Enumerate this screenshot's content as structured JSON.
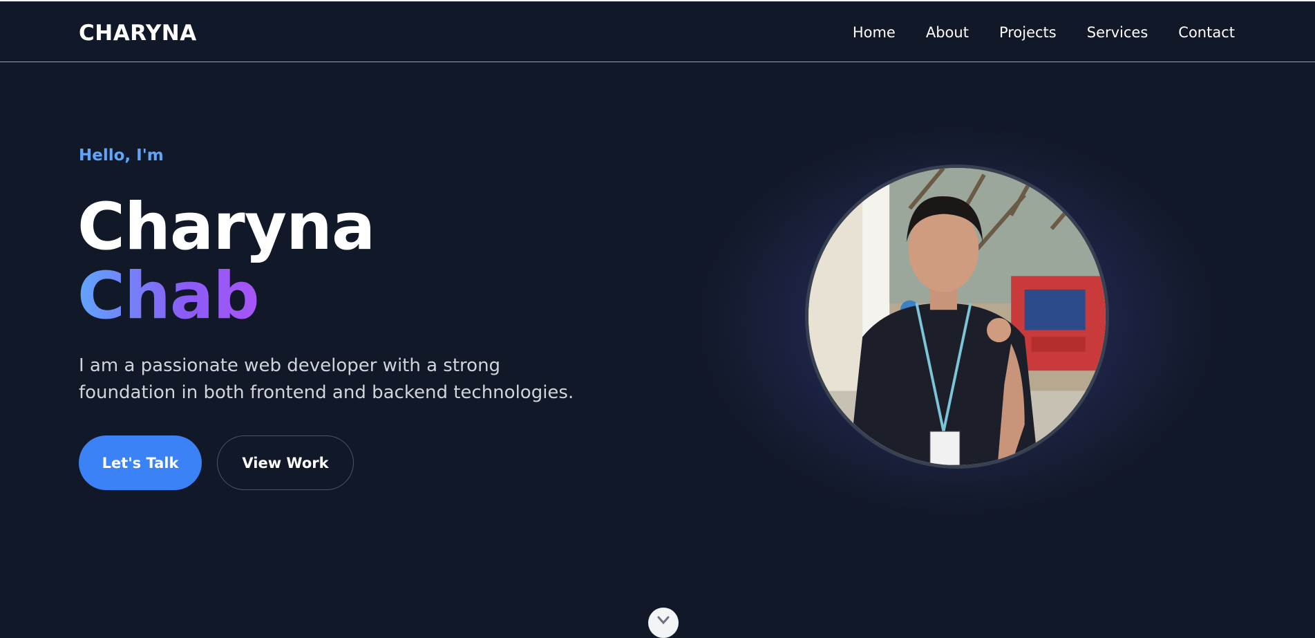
{
  "header": {
    "logo": "CHARYNA",
    "nav": [
      "Home",
      "About",
      "Projects",
      "Services",
      "Contact"
    ]
  },
  "hero": {
    "greeting": "Hello, I'm",
    "first_name": "Charyna",
    "last_name": "Chab",
    "intro": "I am a passionate web developer with a strong foundation in both frontend and backend technologies.",
    "primary_button": "Let's Talk",
    "secondary_button": "View Work"
  },
  "icons": {
    "scroll": "chevron-down-icon",
    "photo": "profile-photo"
  },
  "colors": {
    "background": "#111827",
    "accent": "#3b82f6",
    "greeting": "#60a5fa",
    "gradient_start": "#60a5fa",
    "gradient_end": "#a855f7"
  }
}
